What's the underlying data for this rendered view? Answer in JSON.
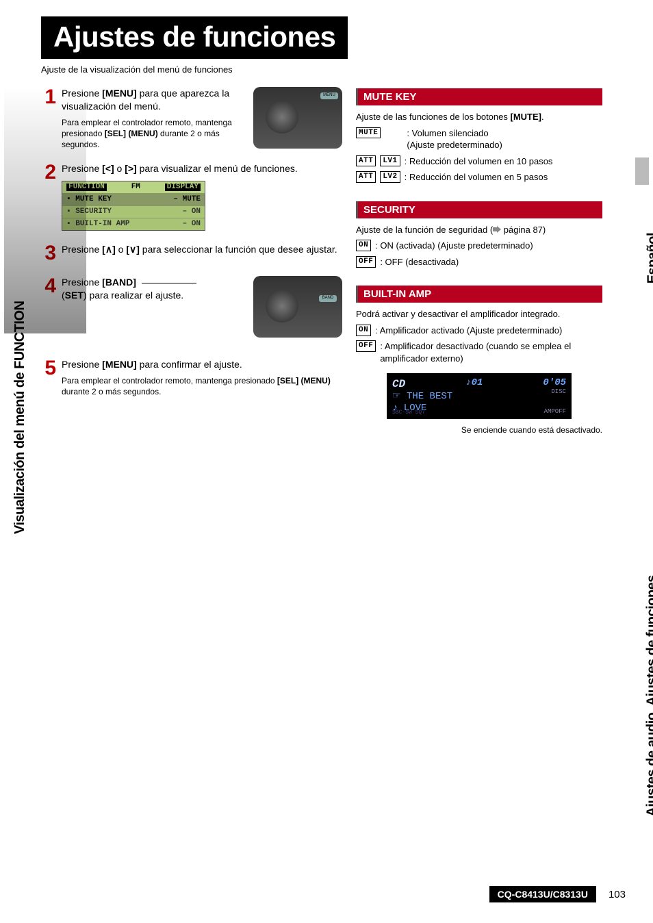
{
  "page": {
    "title": "Ajustes de funciones",
    "subtitle": "Ajuste de la visualización del menú de funciones",
    "model": "CQ-C8413U/C8313U",
    "number": "103"
  },
  "side_labels": {
    "left": "Visualización del menú de FUNCTION",
    "right_bottom": "Ajustes de audio, Ajustes de funciones",
    "right_top": "Español"
  },
  "steps": {
    "s1": {
      "num": "1",
      "text_a": "Presione ",
      "text_b": "[MENU]",
      "text_c": " para que aparezca la visualización del menú.",
      "sub_a": "Para emplear el con­trolador remoto, man­tenga presionado ",
      "sub_b": "[SEL] (MENU)",
      "sub_c": " durante 2 o más segundos."
    },
    "s2": {
      "num": "2",
      "text_a": "Presione ",
      "text_b": "[<]",
      "text_c": " o ",
      "text_d": "[>]",
      "text_e": " para visualizar el menú de funciones."
    },
    "s3": {
      "num": "3",
      "text_a": "Presione ",
      "text_b": "[∧]",
      "text_c": " o ",
      "text_d": "[∨]",
      "text_e": " para seleccionar la función que desee ajustar."
    },
    "s4": {
      "num": "4",
      "text_a": "Presione ",
      "text_b": "[BAND]",
      "text_c": " (",
      "text_d": "SET",
      "text_e": ") para realizar el ajuste."
    },
    "s5": {
      "num": "5",
      "text_a": "Presione ",
      "text_b": "[MENU]",
      "text_c": " para confirmar el ajuste.",
      "sub_a": "Para emplear el controlador remoto, mantenga pre­sionado ",
      "sub_b": "[SEL] (MENU)",
      "sub_c": " durante 2 o más segundos."
    }
  },
  "lcd_menu": {
    "h1": "FUNCTION",
    "h2": "FM",
    "h3": "DISPLAY",
    "r1a": "▪ MUTE KEY",
    "r1b": "– MUTE",
    "r2a": "▪ SECURITY",
    "r2b": "– ON",
    "r3a": "▪ BUILT-IN AMP",
    "r3b": "– ON"
  },
  "mute": {
    "heading": "MUTE KEY",
    "intro_a": "Ajuste de las funciones de los botones ",
    "intro_b": "[MUTE]",
    "intro_c": ".",
    "opt1_chip": "MUTE",
    "opt1_a": ": Volumen silenciado",
    "opt1_b": "(Ajuste predeterminado)",
    "opt2_chip1": "ATT",
    "opt2_chip2": "LV1",
    "opt2_text": ": Reducción del volumen en 10 pasos",
    "opt3_chip1": "ATT",
    "opt3_chip2": "LV2",
    "opt3_text": ": Reducción del volumen en 5 pasos"
  },
  "security": {
    "heading": "SECURITY",
    "intro": "Ajuste de la función de seguridad (",
    "intro_page": " página 87)",
    "on_chip": "ON",
    "on_text": ": ON (activada) (Ajuste predeterminado)",
    "off_chip": "OFF",
    "off_text": ": OFF (desactivada)"
  },
  "amp": {
    "heading": "BUILT-IN AMP",
    "intro": "Podrá activar y desactivar el amplificador integrado.",
    "on_chip": "ON",
    "on_text": ": Amplificador activado (Ajuste predeterminado)",
    "off_chip": "OFF",
    "off_text": ": Amplificador desactivado (cuando se emplea el amplificador externo)",
    "caption": "Se enciende cuando está desactivado."
  },
  "cd_display": {
    "cd": "CD",
    "track": "♪01",
    "time": "0'05",
    "disc": "DISC",
    "line2": "☞ THE BEST",
    "line3": "♪ LOVE",
    "sbc": "SBC-SW  SQ7",
    "ampoff": "AMPOFF"
  },
  "unit_buttons": {
    "menu": "MENU",
    "band": "BAND"
  }
}
